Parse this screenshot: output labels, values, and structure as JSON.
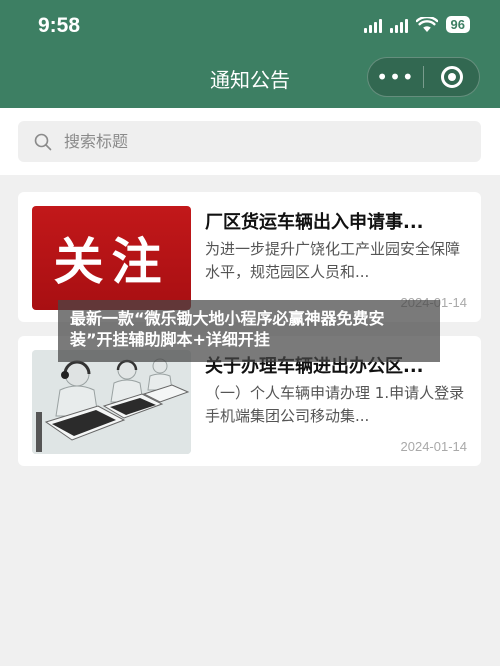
{
  "status_bar": {
    "time": "9:58",
    "battery": "96"
  },
  "nav": {
    "title": "通知公告",
    "more_glyph": "•••"
  },
  "search": {
    "placeholder": "搜索标题"
  },
  "notices": [
    {
      "thumb_text": "关注",
      "title": "厂区货运车辆出入申请事...",
      "summary": "为进一步提升广饶化工产业园安全保障水平，规范园区人员和...",
      "date": "2024-01-14"
    },
    {
      "title": "关于办理车辆进出办公区...",
      "summary": "（一）个人车辆申请办理 1.申请人登录手机端集团公司移动集...",
      "date": "2024-01-14"
    }
  ],
  "overlay_text": "最新一款“微乐锄大地小程序必赢神器免费安装”开挂辅助脚本+详细开挂",
  "colors": {
    "header": "#3d7f63",
    "background": "#f0f0f0",
    "card": "#ffffff",
    "thumb_red": "#b81416"
  }
}
